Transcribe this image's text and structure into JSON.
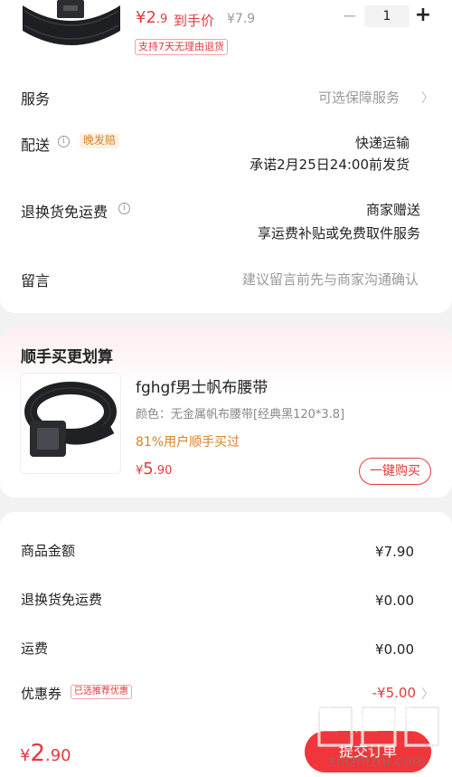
{
  "product": {
    "price_currency": "¥",
    "price_int": "2",
    "price_dec": ".9",
    "price_label": "到手价",
    "original_price": "¥7.9",
    "return_badge": "支持7天无理由退货",
    "quantity": "1",
    "minus": "−",
    "plus": "+"
  },
  "rows": {
    "service": {
      "label": "服务",
      "hint": "可选保障服务"
    },
    "delivery": {
      "label": "配送",
      "badge": "晚发赔",
      "method": "快递运输",
      "promise": "承诺2月25日24:00前发货"
    },
    "return_shipping": {
      "label": "退换货免运费",
      "value1": "商家赠送",
      "value2": "享运费补贴或免费取件服务"
    },
    "message": {
      "label": "留言",
      "placeholder": "建议留言前先与商家沟通确认"
    }
  },
  "recommend": {
    "title": "顺手买更划算",
    "name": "fghgf男士帆布腰带",
    "spec": "颜色：无金属帆布腰带[经典黑120*3.8]",
    "stat": "81%用户顺手买过",
    "price_currency": "¥",
    "price_int": "5",
    "price_dec": ".90",
    "buy_label": "一键购买"
  },
  "summary": {
    "goods_label": "商品金额",
    "goods_value": "¥7.90",
    "return_label": "退换货免运费",
    "return_value": "¥0.00",
    "freight_label": "运费",
    "freight_value": "¥0.00",
    "coupon_label": "优惠券",
    "coupon_badge": "已选推荐优惠",
    "coupon_value": "-¥5.00"
  },
  "bottom": {
    "total_currency": "¥",
    "total_int": "2",
    "total_dec": ".90",
    "submit_label": "提交订单"
  },
  "watermark": {
    "text": "值 值 值",
    "site": "zhizhizhi.com"
  },
  "icons": {
    "chevron": "chevron-right-icon",
    "info": "info-icon"
  },
  "colors": {
    "accent": "#e4393c",
    "orange": "#d4822a",
    "muted": "#999999"
  }
}
